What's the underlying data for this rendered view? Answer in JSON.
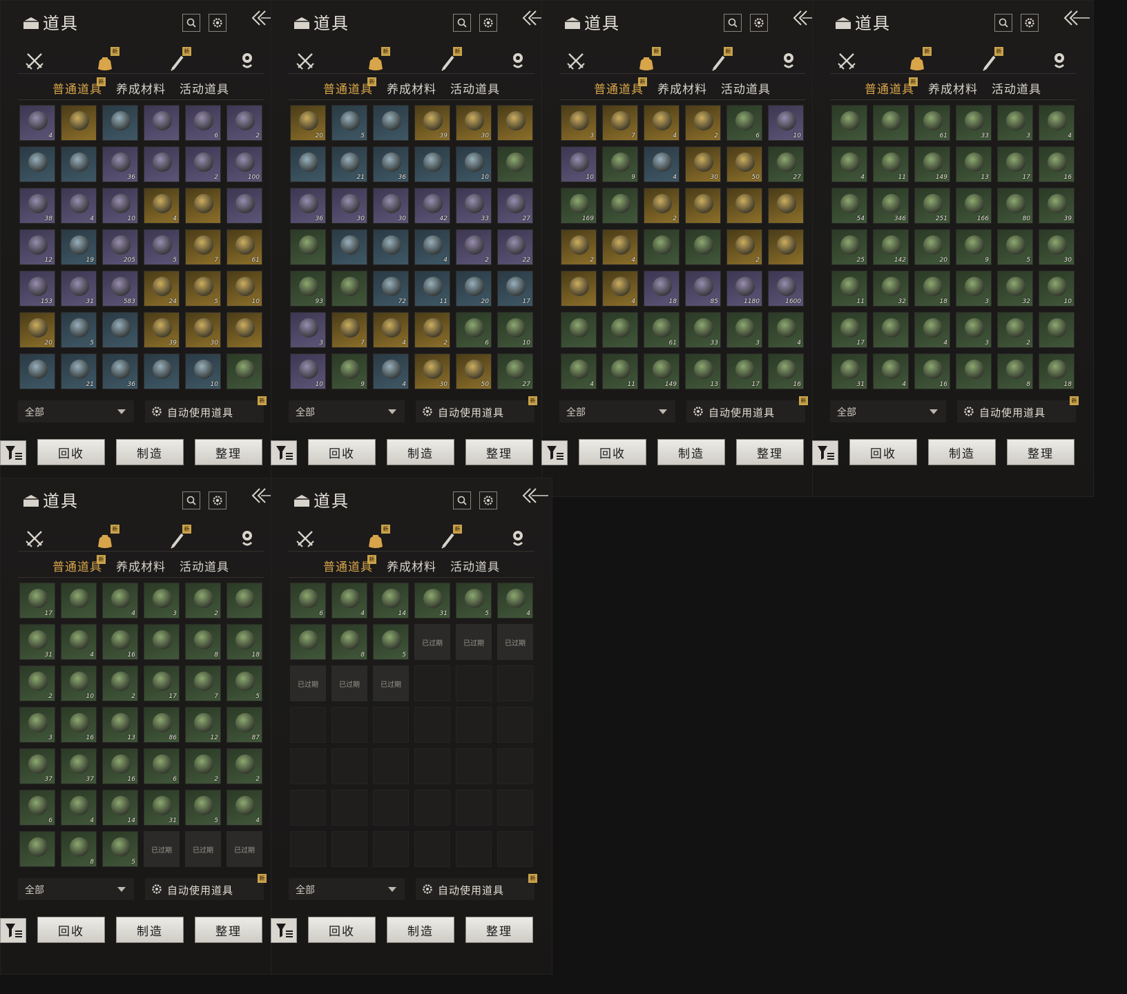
{
  "panel": {
    "title": "道具",
    "search_icon": "search-icon",
    "settings_icon": "gear-icon",
    "back_icon": "collapse-arrows-icon",
    "categories": [
      {
        "icon": "crossed-swords-icon",
        "new": ""
      },
      {
        "icon": "item-bag-icon",
        "new": "新"
      },
      {
        "icon": "scroll-brush-icon",
        "new": "新"
      },
      {
        "icon": "location-pin-icon",
        "new": ""
      }
    ],
    "subtabs": [
      {
        "label": "普通道具",
        "new": "新"
      },
      {
        "label": "养成材料",
        "new": ""
      },
      {
        "label": "活动道具",
        "new": ""
      }
    ],
    "filter_value": "全部",
    "auto_use_label": "自动使用道具",
    "auto_use_new": "新",
    "buttons": {
      "recycle": "回收",
      "craft": "制造",
      "sort": "整理"
    },
    "expired_label": "已过期"
  },
  "colors": {
    "accent_gold": "#d9a54a",
    "rarity_purple": "#5d5577",
    "rarity_gold": "#8c6f2a",
    "rarity_blue": "#3f5866",
    "rarity_green": "#41573a",
    "rarity_gray": "#4a4944",
    "new_badge": "#c9a24a"
  },
  "panels": [
    {
      "items": [
        [
          "p",
          "4"
        ],
        [
          "g",
          ""
        ],
        [
          "b",
          ""
        ],
        [
          "p",
          ""
        ],
        [
          "p",
          "6"
        ],
        [
          "p",
          "2"
        ],
        [
          "b",
          ""
        ],
        [
          "b",
          ""
        ],
        [
          "p",
          "36"
        ],
        [
          "p",
          ""
        ],
        [
          "p",
          "2"
        ],
        [
          "p",
          "100"
        ],
        [
          "p",
          "38"
        ],
        [
          "p",
          "4"
        ],
        [
          "p",
          "10"
        ],
        [
          "g",
          "4"
        ],
        [
          "g",
          ""
        ],
        [
          "p",
          ""
        ],
        [
          "p",
          "12"
        ],
        [
          "b",
          "19"
        ],
        [
          "p",
          "205"
        ],
        [
          "p",
          "5"
        ],
        [
          "g",
          "7"
        ],
        [
          "g",
          "61"
        ],
        [
          "p",
          "153"
        ],
        [
          "p",
          "31"
        ],
        [
          "p",
          "583"
        ],
        [
          "g",
          "24"
        ],
        [
          "g",
          "5"
        ],
        [
          "g",
          "10"
        ],
        [
          "g",
          "20"
        ],
        [
          "b",
          "5"
        ],
        [
          "b",
          ""
        ],
        [
          "g",
          "39"
        ],
        [
          "g",
          "30"
        ],
        [
          "g",
          ""
        ],
        [
          "b",
          ""
        ],
        [
          "b",
          "21"
        ],
        [
          "b",
          "36"
        ],
        [
          "b",
          ""
        ],
        [
          "b",
          "10"
        ],
        [
          "n",
          ""
        ]
      ]
    },
    {
      "items": [
        [
          "g",
          "20"
        ],
        [
          "b",
          "5"
        ],
        [
          "b",
          ""
        ],
        [
          "g",
          "39"
        ],
        [
          "g",
          "30"
        ],
        [
          "g",
          ""
        ],
        [
          "b",
          ""
        ],
        [
          "b",
          "21"
        ],
        [
          "b",
          "36"
        ],
        [
          "b",
          ""
        ],
        [
          "b",
          "10"
        ],
        [
          "n",
          ""
        ],
        [
          "p",
          "36"
        ],
        [
          "p",
          "30"
        ],
        [
          "p",
          "30"
        ],
        [
          "p",
          "42"
        ],
        [
          "p",
          "33"
        ],
        [
          "p",
          "27"
        ],
        [
          "n",
          ""
        ],
        [
          "b",
          ""
        ],
        [
          "b",
          ""
        ],
        [
          "b",
          "4"
        ],
        [
          "p",
          "2"
        ],
        [
          "p",
          "22"
        ],
        [
          "n",
          "93"
        ],
        [
          "n",
          ""
        ],
        [
          "b",
          "72"
        ],
        [
          "b",
          "11"
        ],
        [
          "b",
          "20"
        ],
        [
          "b",
          "17"
        ],
        [
          "p",
          "3"
        ],
        [
          "g",
          "7"
        ],
        [
          "g",
          "4"
        ],
        [
          "g",
          "2"
        ],
        [
          "n",
          "6"
        ],
        [
          "n",
          "10"
        ],
        [
          "p",
          "10"
        ],
        [
          "n",
          "9"
        ],
        [
          "b",
          "4"
        ],
        [
          "g",
          "30"
        ],
        [
          "g",
          "50"
        ],
        [
          "n",
          "27"
        ]
      ]
    },
    {
      "items": [
        [
          "g",
          "3"
        ],
        [
          "g",
          "7"
        ],
        [
          "g",
          "4"
        ],
        [
          "g",
          "2"
        ],
        [
          "n",
          "6"
        ],
        [
          "p",
          "10"
        ],
        [
          "p",
          "10"
        ],
        [
          "n",
          "9"
        ],
        [
          "b",
          "4"
        ],
        [
          "g",
          "30"
        ],
        [
          "g",
          "50"
        ],
        [
          "n",
          "27"
        ],
        [
          "n",
          "169"
        ],
        [
          "n",
          ""
        ],
        [
          "g",
          "2"
        ],
        [
          "g",
          ""
        ],
        [
          "g",
          ""
        ],
        [
          "g",
          ""
        ],
        [
          "g",
          "2"
        ],
        [
          "g",
          "4"
        ],
        [
          "n",
          ""
        ],
        [
          "n",
          ""
        ],
        [
          "g",
          "2"
        ],
        [
          "g",
          ""
        ],
        [
          "g",
          ""
        ],
        [
          "g",
          "4"
        ],
        [
          "p",
          "18"
        ],
        [
          "p",
          "85"
        ],
        [
          "p",
          "1180"
        ],
        [
          "p",
          "1600"
        ],
        [
          "n",
          ""
        ],
        [
          "n",
          ""
        ],
        [
          "n",
          "61"
        ],
        [
          "n",
          "33"
        ],
        [
          "n",
          "3"
        ],
        [
          "n",
          "4"
        ],
        [
          "n",
          "4"
        ],
        [
          "n",
          "11"
        ],
        [
          "n",
          "149"
        ],
        [
          "n",
          "13"
        ],
        [
          "n",
          "17"
        ],
        [
          "n",
          "16"
        ]
      ]
    },
    {
      "items": [
        [
          "n",
          ""
        ],
        [
          "n",
          ""
        ],
        [
          "n",
          "61"
        ],
        [
          "n",
          "33"
        ],
        [
          "n",
          "3"
        ],
        [
          "n",
          "4"
        ],
        [
          "n",
          "4"
        ],
        [
          "n",
          "11"
        ],
        [
          "n",
          "149"
        ],
        [
          "n",
          "13"
        ],
        [
          "n",
          "17"
        ],
        [
          "n",
          "16"
        ],
        [
          "n",
          "54"
        ],
        [
          "n",
          "346"
        ],
        [
          "n",
          "251"
        ],
        [
          "n",
          "166"
        ],
        [
          "n",
          "80"
        ],
        [
          "n",
          "39"
        ],
        [
          "n",
          "25"
        ],
        [
          "n",
          "142"
        ],
        [
          "n",
          "20"
        ],
        [
          "n",
          "9"
        ],
        [
          "n",
          "5"
        ],
        [
          "n",
          "30"
        ],
        [
          "n",
          "11"
        ],
        [
          "n",
          "32"
        ],
        [
          "n",
          "18"
        ],
        [
          "n",
          "3"
        ],
        [
          "n",
          "32"
        ],
        [
          "n",
          "10"
        ],
        [
          "n",
          "17"
        ],
        [
          "n",
          ""
        ],
        [
          "n",
          "4"
        ],
        [
          "n",
          "3"
        ],
        [
          "n",
          "2"
        ],
        [
          "n",
          ""
        ],
        [
          "n",
          "31"
        ],
        [
          "n",
          "4"
        ],
        [
          "n",
          "16"
        ],
        [
          "n",
          ""
        ],
        [
          "n",
          "8"
        ],
        [
          "n",
          "18"
        ]
      ]
    },
    {
      "items": [
        [
          "n",
          "17"
        ],
        [
          "n",
          ""
        ],
        [
          "n",
          "4"
        ],
        [
          "n",
          "3"
        ],
        [
          "n",
          "2"
        ],
        [
          "n",
          ""
        ],
        [
          "n",
          "31"
        ],
        [
          "n",
          "4"
        ],
        [
          "n",
          "16"
        ],
        [
          "n",
          ""
        ],
        [
          "n",
          "8"
        ],
        [
          "n",
          "18"
        ],
        [
          "n",
          "2"
        ],
        [
          "n",
          "10"
        ],
        [
          "n",
          "2"
        ],
        [
          "n",
          "17"
        ],
        [
          "n",
          "7"
        ],
        [
          "n",
          "5"
        ],
        [
          "n",
          "3"
        ],
        [
          "n",
          "16"
        ],
        [
          "n",
          "13"
        ],
        [
          "n",
          "86"
        ],
        [
          "n",
          "12"
        ],
        [
          "n",
          "87"
        ],
        [
          "n",
          "37"
        ],
        [
          "n",
          "37"
        ],
        [
          "n",
          "16"
        ],
        [
          "n",
          "6"
        ],
        [
          "n",
          "2"
        ],
        [
          "n",
          "2"
        ],
        [
          "n",
          "6"
        ],
        [
          "n",
          "4"
        ],
        [
          "n",
          "14"
        ],
        [
          "n",
          "31"
        ],
        [
          "n",
          "5"
        ],
        [
          "n",
          "4"
        ],
        [
          "n",
          ""
        ],
        [
          "n",
          "8"
        ],
        [
          "n",
          "5"
        ],
        [
          "x",
          ""
        ],
        [
          "x",
          ""
        ],
        [
          "x",
          ""
        ]
      ]
    },
    {
      "items": [
        [
          "n",
          "6"
        ],
        [
          "n",
          "4"
        ],
        [
          "n",
          "14"
        ],
        [
          "n",
          "31"
        ],
        [
          "n",
          "5"
        ],
        [
          "n",
          "4"
        ],
        [
          "n",
          ""
        ],
        [
          "n",
          "8"
        ],
        [
          "n",
          "5"
        ],
        [
          "x",
          ""
        ],
        [
          "x",
          ""
        ],
        [
          "x",
          ""
        ],
        [
          "x",
          ""
        ],
        [
          "x",
          ""
        ],
        [
          "x",
          ""
        ],
        [
          "e",
          ""
        ],
        [
          "e",
          ""
        ],
        [
          "e",
          ""
        ],
        [
          "e",
          ""
        ],
        [
          "e",
          ""
        ],
        [
          "e",
          ""
        ],
        [
          "e",
          ""
        ],
        [
          "e",
          ""
        ],
        [
          "e",
          ""
        ],
        [
          "e",
          ""
        ],
        [
          "e",
          ""
        ],
        [
          "e",
          ""
        ],
        [
          "e",
          ""
        ],
        [
          "e",
          ""
        ],
        [
          "e",
          ""
        ],
        [
          "e",
          ""
        ],
        [
          "e",
          ""
        ],
        [
          "e",
          ""
        ],
        [
          "e",
          ""
        ],
        [
          "e",
          ""
        ],
        [
          "e",
          ""
        ],
        [
          "e",
          ""
        ],
        [
          "e",
          ""
        ],
        [
          "e",
          ""
        ],
        [
          "e",
          ""
        ],
        [
          "e",
          ""
        ],
        [
          "e",
          ""
        ]
      ]
    }
  ]
}
